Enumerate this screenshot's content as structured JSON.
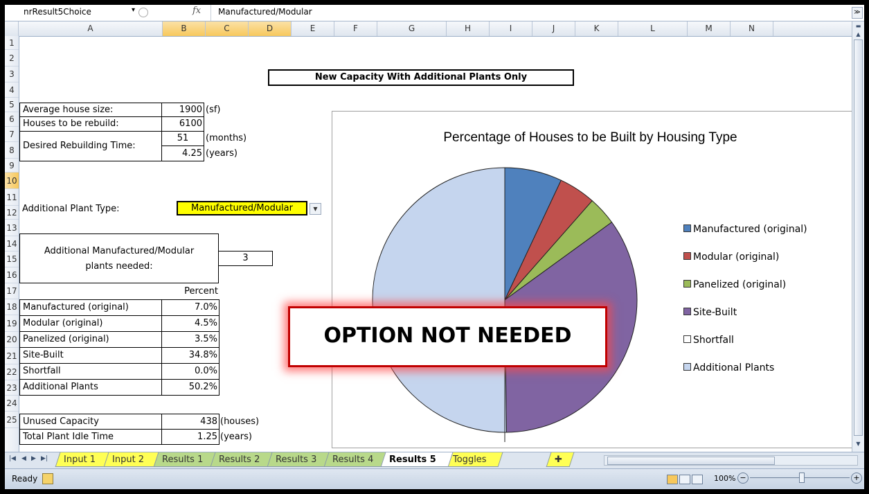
{
  "formula_bar": {
    "name_box": "nrResult5Choice",
    "fx": "fx",
    "value": "Manufactured/Modular"
  },
  "columns": [
    "A",
    "B",
    "C",
    "D",
    "E",
    "F",
    "G",
    "H",
    "I",
    "J",
    "K",
    "L",
    "M",
    "N"
  ],
  "rows": [
    "1",
    "2",
    "3",
    "4",
    "5",
    "6",
    "7",
    "8",
    "9",
    "10",
    "11",
    "12",
    "13",
    "14",
    "15",
    "16",
    "17",
    "18",
    "19",
    "20",
    "21",
    "22",
    "23",
    "24",
    "25"
  ],
  "sheet": {
    "title": "New Capacity With Additional Plants Only",
    "inputs": {
      "avg_house_label": "Average house size:",
      "avg_house_value": "1900",
      "avg_house_unit": "(sf)",
      "houses_label": "Houses to be rebuild:",
      "houses_value": "6100",
      "time_label": "Desired Rebuilding Time:",
      "time_months": "51",
      "time_months_unit": "(months)",
      "time_years": "4.25",
      "time_years_unit": "(years)"
    },
    "plant_type_label": "Additional Plant Type:",
    "plant_type_value": "Manufactured/Modular",
    "plants_needed_label_1": "Additional Manufactured/Modular",
    "plants_needed_label_2": "plants needed:",
    "plants_needed_value": "3",
    "percent_header": "Percent",
    "breakdown": [
      {
        "label": "Manufactured (original)",
        "value": "7.0%"
      },
      {
        "label": "Modular (original)",
        "value": "4.5%"
      },
      {
        "label": "Panelized (original)",
        "value": "3.5%"
      },
      {
        "label": "Site-Built",
        "value": "34.8%"
      },
      {
        "label": "Shortfall",
        "value": "0.0%"
      },
      {
        "label": "Additional Plants",
        "value": "50.2%"
      }
    ],
    "unused_label": "Unused Capacity",
    "unused_value": "438",
    "unused_unit": "(houses)",
    "idle_label": "Total Plant Idle Time",
    "idle_value": "1.25",
    "idle_unit": "(years)"
  },
  "chart_data": {
    "type": "pie",
    "title": "Percentage of Houses to be Built by Housing Type",
    "categories": [
      "Manufactured (original)",
      "Modular (original)",
      "Panelized (original)",
      "Site-Built",
      "Shortfall",
      "Additional Plants"
    ],
    "values": [
      7.0,
      4.5,
      3.5,
      34.8,
      0.0,
      50.2
    ],
    "colors": [
      "#4f81bd",
      "#c0504d",
      "#9bbb59",
      "#8064a2",
      "#ffffff",
      "#c5d5ee"
    ],
    "legend_position": "right"
  },
  "overlay_text": "OPTION NOT NEEDED",
  "tabs": [
    {
      "label": "Input 1",
      "color": "y"
    },
    {
      "label": "Input 2",
      "color": "y"
    },
    {
      "label": "Results 1",
      "color": "g"
    },
    {
      "label": "Results 2",
      "color": "g"
    },
    {
      "label": "Results 3",
      "color": "g"
    },
    {
      "label": "Results 4",
      "color": "g"
    },
    {
      "label": "Results 5",
      "color": "act"
    },
    {
      "label": "Toggles",
      "color": "y"
    }
  ],
  "status": {
    "ready": "Ready",
    "zoom": "100%"
  }
}
